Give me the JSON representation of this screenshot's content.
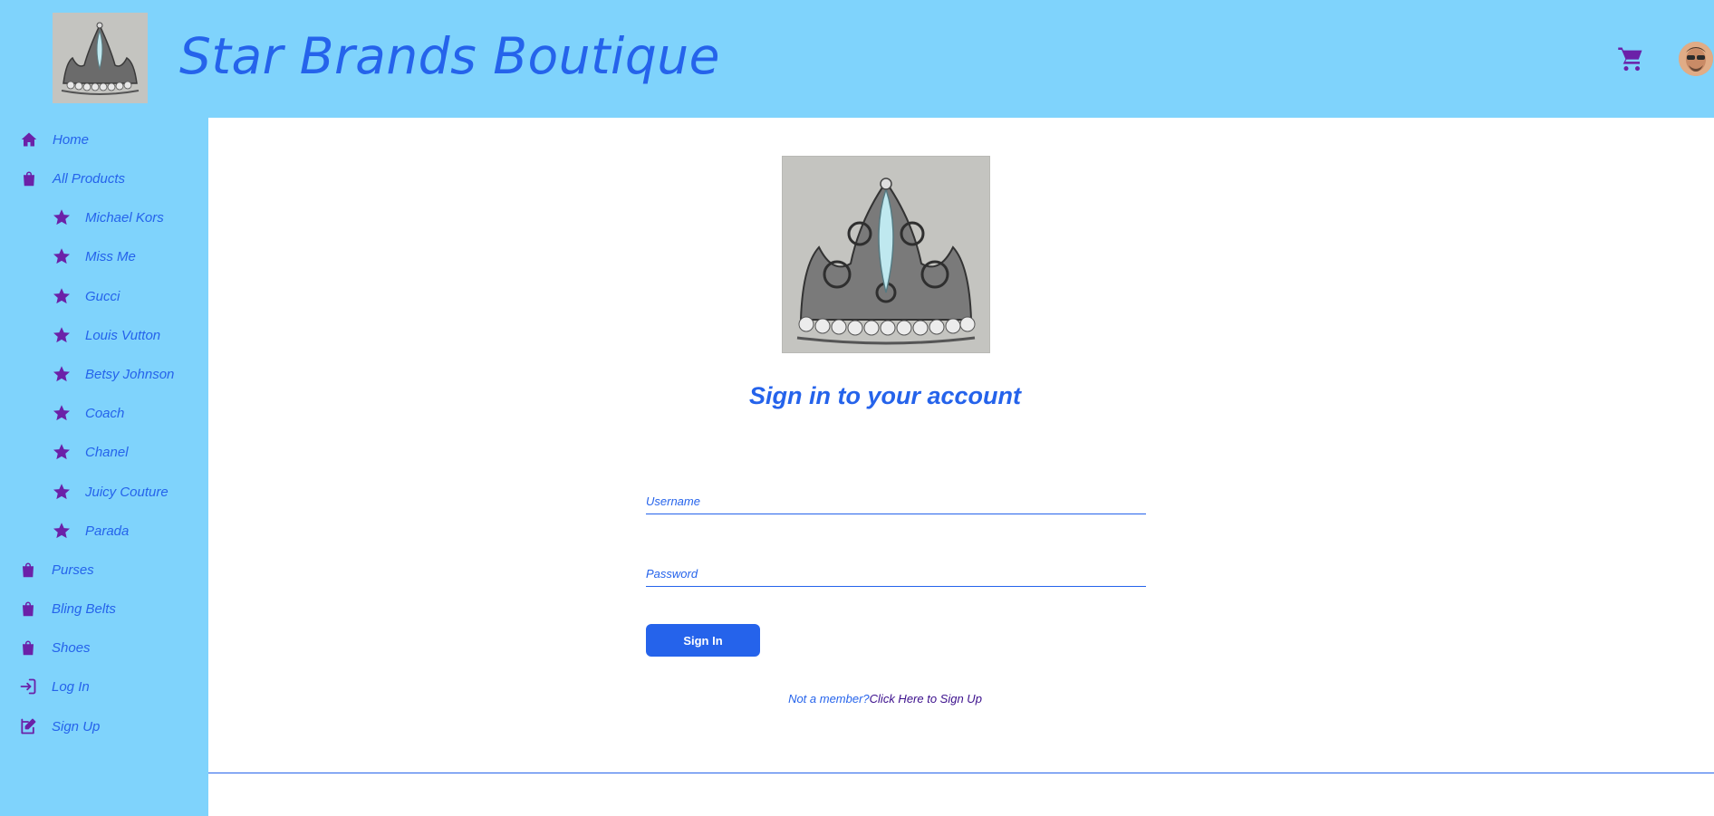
{
  "header": {
    "title": "Star Brands Boutique",
    "cart_icon": "cart-icon",
    "avatar": "user-avatar"
  },
  "sidebar": {
    "items": [
      {
        "label": "Home",
        "icon": "home-icon",
        "indent": false
      },
      {
        "label": "All Products",
        "icon": "bag-icon",
        "indent": false
      },
      {
        "label": "Michael Kors",
        "icon": "star-icon",
        "indent": true
      },
      {
        "label": "Miss Me",
        "icon": "star-icon",
        "indent": true
      },
      {
        "label": "Gucci",
        "icon": "star-icon",
        "indent": true
      },
      {
        "label": "Louis Vutton",
        "icon": "star-icon",
        "indent": true
      },
      {
        "label": "Betsy Johnson",
        "icon": "star-icon",
        "indent": true
      },
      {
        "label": "Coach",
        "icon": "star-icon",
        "indent": true
      },
      {
        "label": "Chanel",
        "icon": "star-icon",
        "indent": true
      },
      {
        "label": "Juicy Couture",
        "icon": "star-icon",
        "indent": true
      },
      {
        "label": "Parada",
        "icon": "star-icon",
        "indent": true
      },
      {
        "label": "Purses",
        "icon": "bag-icon",
        "indent": false
      },
      {
        "label": "Bling Belts",
        "icon": "bag-icon",
        "indent": false
      },
      {
        "label": "Shoes",
        "icon": "bag-icon",
        "indent": false
      },
      {
        "label": "Log In",
        "icon": "login-icon",
        "indent": false
      },
      {
        "label": "Sign Up",
        "icon": "signup-icon",
        "indent": false
      }
    ]
  },
  "main": {
    "heading": "Sign in to your account",
    "username_placeholder": "Username",
    "password_placeholder": "Password",
    "signin_label": "Sign In",
    "not_member": "Not a member?",
    "signup_link": "Click Here to Sign Up"
  },
  "colors": {
    "background": "#7fd3fc",
    "accent": "#2563eb",
    "icon": "#6b21a8",
    "link_dark": "#3b0f8c"
  }
}
